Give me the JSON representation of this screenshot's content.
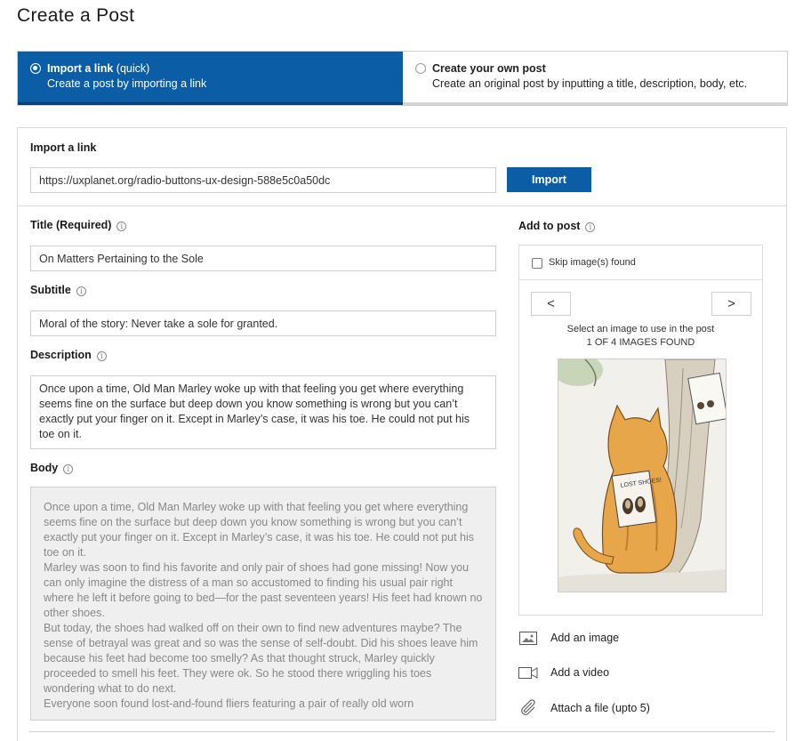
{
  "page": {
    "title": "Create a Post"
  },
  "modes": {
    "import": {
      "title": "Import a link",
      "suffix": " (quick)",
      "description": "Create a post by importing a link",
      "selected": true
    },
    "create": {
      "title": "Create your own post",
      "description": "Create an original post by inputting a title, description, body, etc.",
      "selected": false
    }
  },
  "import_section": {
    "label": "Import a link",
    "url_value": "https://uxplanet.org/radio-buttons-ux-design-588e5c0a50dc",
    "button_label": "Import"
  },
  "form": {
    "title": {
      "label": "Title (Required)",
      "value": "On Matters Pertaining to the Sole"
    },
    "subtitle": {
      "label": "Subtitle",
      "value": "Moral of the story: Never take a sole for granted."
    },
    "description": {
      "label": "Description",
      "value": "Once upon a time, Old Man Marley woke up with that feeling you get where everything seems fine on the surface but deep down you know something is wrong but you can’t exactly put your finger on it. Except in Marley’s case, it was his toe. He could not put his toe on it."
    },
    "body": {
      "label": "Body",
      "paragraphs": [
        "Once upon a time, Old Man Marley woke up with that feeling you get where everything seems fine on the surface but deep down you know something is wrong but you can’t exactly put your finger on it. Except in Marley’s case, it was his toe. He could not put his toe on it.",
        "Marley was soon to find his favorite and only pair of shoes had gone missing! Now you can only imagine the distress of a man so accustomed to finding his usual pair right where he left it before going to bed—for the past seventeen years! His feet had known no other shoes.",
        "But today, the shoes had walked off on their own to find new adventures maybe? The sense of betrayal was great and so was the sense of self-doubt. Did his shoes leave him because his feet had become too smelly? As that thought struck, Marley quickly proceeded to smell his feet. They were ok. So he stood there wriggling his toes wondering what to do next.",
        "Everyone soon found lost-and-found fliers featuring a pair of really old worn"
      ]
    }
  },
  "add_to_post": {
    "label": "Add to post",
    "skip_label": "Skip image(s) found",
    "prev_symbol": "<",
    "next_symbol": ">",
    "select_text": "Select an image to use in the post",
    "count_text": "1 OF 4 IMAGES FOUND",
    "flier_text": "LOST SHOES!",
    "actions": {
      "image": "Add an image",
      "video": "Add a video",
      "file": "Attach a file (upto 5)"
    }
  },
  "colors": {
    "primary": "#0b5ea5",
    "primary_dark": "#0a3f6e",
    "border": "#cfcfcf"
  },
  "icons": [
    "info-icon",
    "image-icon",
    "video-icon",
    "paperclip-icon",
    "chevron-left-icon",
    "chevron-right-icon"
  ]
}
